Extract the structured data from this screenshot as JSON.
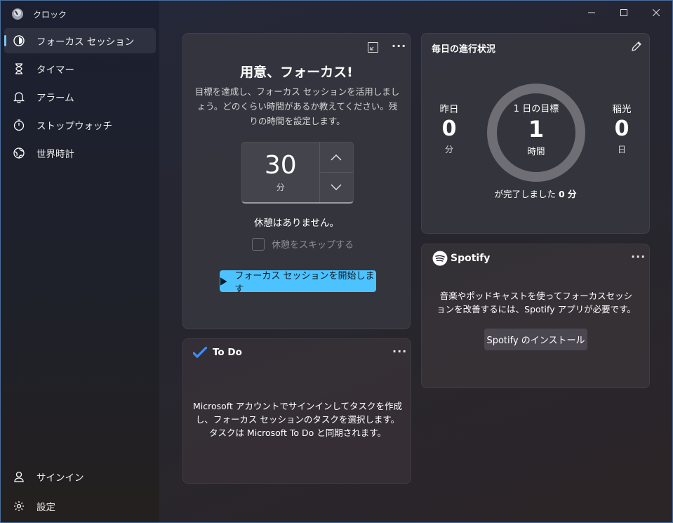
{
  "app": {
    "title": "クロック"
  },
  "nav": {
    "items": [
      {
        "label": "フォーカス セッション",
        "icon": "focus-icon"
      },
      {
        "label": "タイマー",
        "icon": "hourglass-icon"
      },
      {
        "label": "アラーム",
        "icon": "bell-icon"
      },
      {
        "label": "ストップウォッチ",
        "icon": "stopwatch-icon"
      },
      {
        "label": "世界時計",
        "icon": "globe-icon"
      }
    ],
    "bottom": [
      {
        "label": "サインイン",
        "icon": "person-icon"
      },
      {
        "label": "設定",
        "icon": "gear-icon"
      }
    ]
  },
  "focus": {
    "title": "用意、フォーカス!",
    "description": "目標を達成し、フォーカス セッションを活用しましょう。どのくらい時間があるか教えてください。残りの時間を設定します。",
    "minutes": "30",
    "unit": "分",
    "break_text": "休憩はありません。",
    "skip_label": "休憩をスキップする",
    "start_label": "フォーカス セッションを開始します"
  },
  "progress": {
    "title": "毎日の進行状況",
    "yesterday": {
      "label": "昨日",
      "value": "0",
      "unit": "分"
    },
    "goal": {
      "label": "1 日の目標",
      "value": "1",
      "unit": "時間"
    },
    "streak": {
      "label": "稲光",
      "value": "0",
      "unit": "日"
    },
    "complete_prefix": "が完了しました",
    "complete_value": "0 分",
    "goal_progress": 0
  },
  "spotify": {
    "brand": "Spotify",
    "description": "音楽やポッドキャストを使ってフォーカスセッションを改善するには、Spotify アプリが必要です。",
    "install_label": "Spotify のインストール"
  },
  "todo": {
    "title": "To Do",
    "description": "Microsoft アカウントでサインインしてタスクを作成し、フォーカス セッションのタスクを選択します。タスクは Microsoft To Do と同期されます。"
  },
  "colors": {
    "accent": "#4cc2ff",
    "ring": "#6e6e74"
  }
}
